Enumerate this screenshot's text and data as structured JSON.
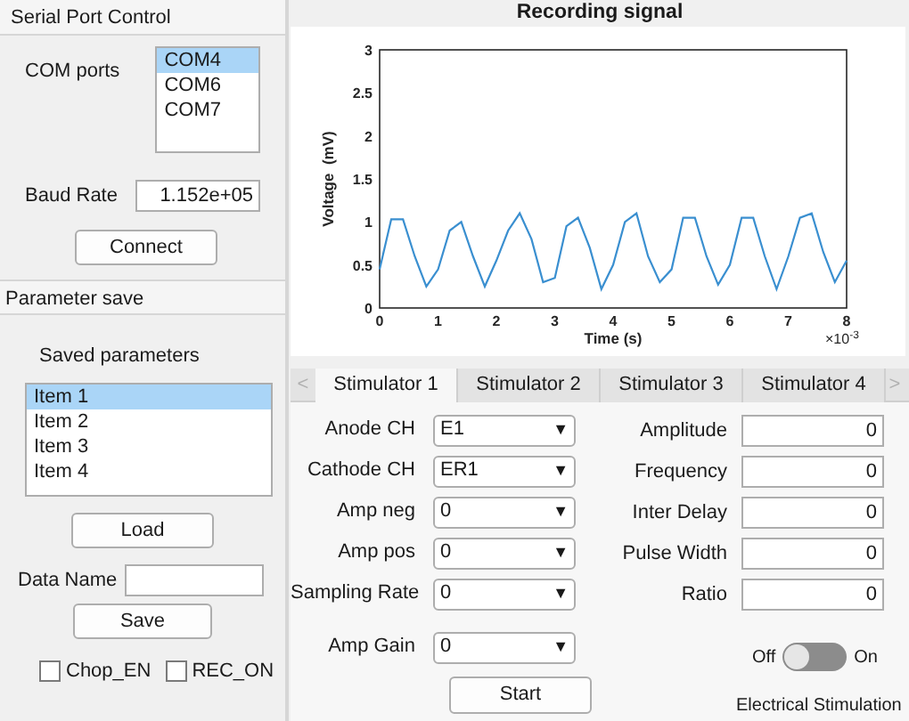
{
  "serial_port_control": {
    "title": "Serial Port Control",
    "com_ports_label": "COM ports",
    "com_ports": [
      {
        "label": "COM4",
        "selected": true
      },
      {
        "label": "COM6",
        "selected": false
      },
      {
        "label": "COM7",
        "selected": false
      }
    ],
    "baud_rate_label": "Baud Rate",
    "baud_rate": "1.152e+05",
    "connect_button": "Connect"
  },
  "parameter_save": {
    "title": "Parameter save",
    "saved_label": "Saved parameters",
    "items": [
      {
        "label": "Item 1",
        "selected": true
      },
      {
        "label": "Item 2",
        "selected": false
      },
      {
        "label": "Item 3",
        "selected": false
      },
      {
        "label": "Item 4",
        "selected": false
      }
    ],
    "load_button": "Load",
    "data_name_label": "Data Name",
    "save_button": "Save",
    "checkboxes": [
      {
        "label": "Chop_EN",
        "checked": false
      },
      {
        "label": "REC_ON",
        "checked": false
      }
    ]
  },
  "chart": {
    "title": "Recording signal",
    "exponent": "×10$^{-3}$",
    "chart_data": {
      "type": "line",
      "xlabel": "Time (s)",
      "ylabel": "Voltage  (mV)",
      "xlim": [
        0,
        8
      ],
      "ylim": [
        0,
        3
      ],
      "xticks": [
        0,
        1,
        2,
        3,
        4,
        5,
        6,
        7,
        8
      ],
      "yticks": [
        0,
        0.5,
        1,
        1.5,
        2,
        2.5,
        3
      ],
      "x": [
        0,
        0.2,
        0.4,
        0.6,
        0.8,
        1,
        1.2,
        1.4,
        1.6,
        1.8,
        2,
        2.2,
        2.4,
        2.6,
        2.8,
        3,
        3.2,
        3.4,
        3.6,
        3.8,
        4,
        4.2,
        4.4,
        4.6,
        4.8,
        5,
        5.2,
        5.4,
        5.6,
        5.8,
        6,
        6.2,
        6.4,
        6.6,
        6.8,
        7,
        7.2,
        7.4,
        7.6,
        7.8,
        8
      ],
      "series": [
        {
          "color": "#3a8fd0",
          "values": [
            0.45,
            1.03,
            1.03,
            0.6,
            0.25,
            0.45,
            0.9,
            1.0,
            0.6,
            0.25,
            0.55,
            0.9,
            1.1,
            0.8,
            0.3,
            0.35,
            0.95,
            1.05,
            0.7,
            0.22,
            0.5,
            1.0,
            1.1,
            0.6,
            0.3,
            0.45,
            1.05,
            1.05,
            0.6,
            0.27,
            0.5,
            1.05,
            1.05,
            0.6,
            0.22,
            0.6,
            1.05,
            1.1,
            0.65,
            0.3,
            0.55
          ]
        }
      ]
    }
  },
  "tabs": {
    "prev": "<",
    "next": ">",
    "items": [
      {
        "label": "Stimulator 1",
        "selected": true
      },
      {
        "label": "Stimulator 2",
        "selected": false
      },
      {
        "label": "Stimulator 3",
        "selected": false
      },
      {
        "label": "Stimulator 4",
        "selected": false
      }
    ]
  },
  "dropdowns": [
    {
      "label": "Anode CH",
      "value": "E1"
    },
    {
      "label": "Cathode CH",
      "value": "ER1"
    },
    {
      "label": "Amp neg",
      "value": "0"
    },
    {
      "label": "Amp pos",
      "value": "0"
    },
    {
      "label": "Sampling Rate",
      "value": "0"
    },
    {
      "label": "Amp Gain",
      "value": "0"
    }
  ],
  "dropdown_arrow": "▼",
  "fields": [
    {
      "label": "Amplitude",
      "value": "0"
    },
    {
      "label": "Frequency",
      "value": "0"
    },
    {
      "label": "Inter Delay",
      "value": "0"
    },
    {
      "label": "Pulse Width",
      "value": "0"
    },
    {
      "label": "Ratio",
      "value": "0"
    }
  ],
  "start_button": "Start",
  "switch": {
    "off_label": "Off",
    "on_label": "On",
    "on": false,
    "caption": "Electrical Stimulation"
  }
}
